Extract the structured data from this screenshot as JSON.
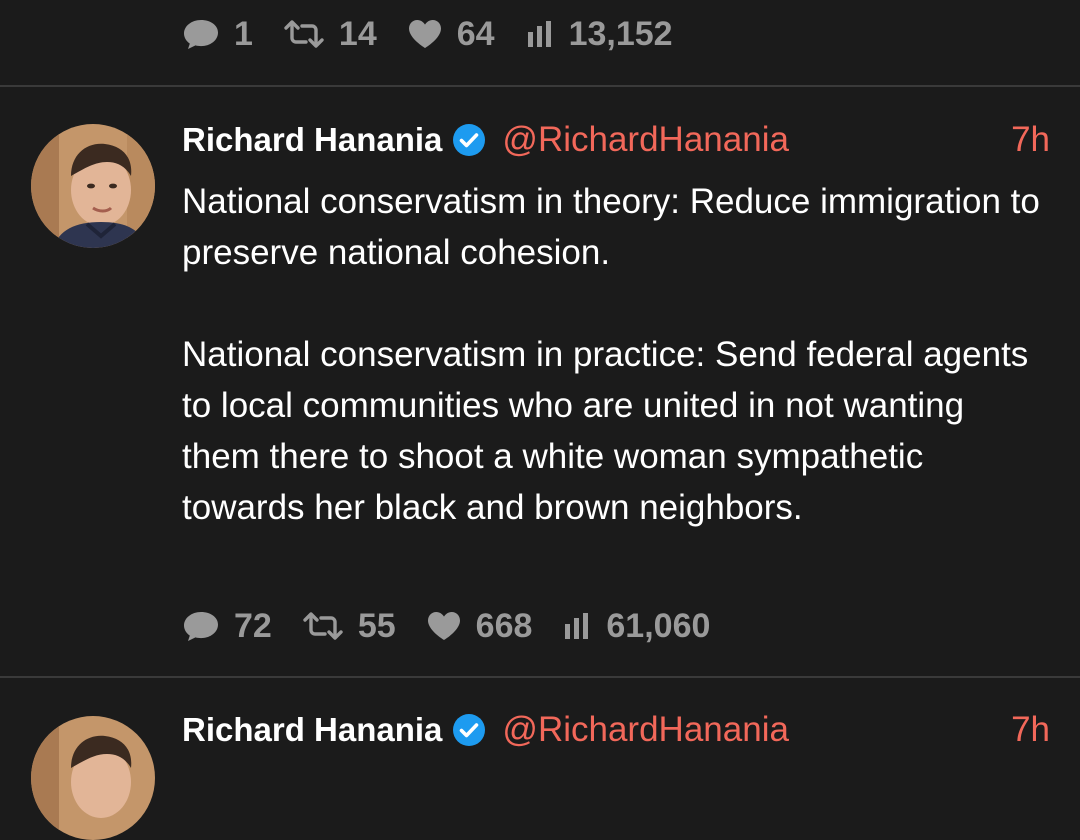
{
  "colors": {
    "background": "#1b1b1b",
    "divider": "#3a3a3a",
    "accent": "#f2685a",
    "muted": "#9a9a9a",
    "verified": "#1d9bf0"
  },
  "prev_tweet": {
    "stats": {
      "replies": "1",
      "retweets": "14",
      "likes": "64",
      "views": "13,152"
    }
  },
  "tweet": {
    "author_name": "Richard Hanania",
    "handle": "@RichardHanania",
    "time": "7h",
    "verified_icon": "verified-badge-icon",
    "paragraphs": [
      "National conservatism in theory: Reduce immigration to preserve national cohesion.",
      "National conservatism in practice: Send federal agents to local communities who are united in not wanting them there to shoot a white woman sympathetic towards her black and brown neighbors."
    ],
    "stats": {
      "replies": "72",
      "retweets": "55",
      "likes": "668",
      "views": "61,060"
    }
  },
  "next_tweet": {
    "author_name": "Richard Hanania",
    "handle": "@RichardHanania",
    "time": "7h"
  },
  "icons": {
    "reply": "reply-icon",
    "retweet": "retweet-icon",
    "like": "heart-icon",
    "views": "views-icon"
  }
}
